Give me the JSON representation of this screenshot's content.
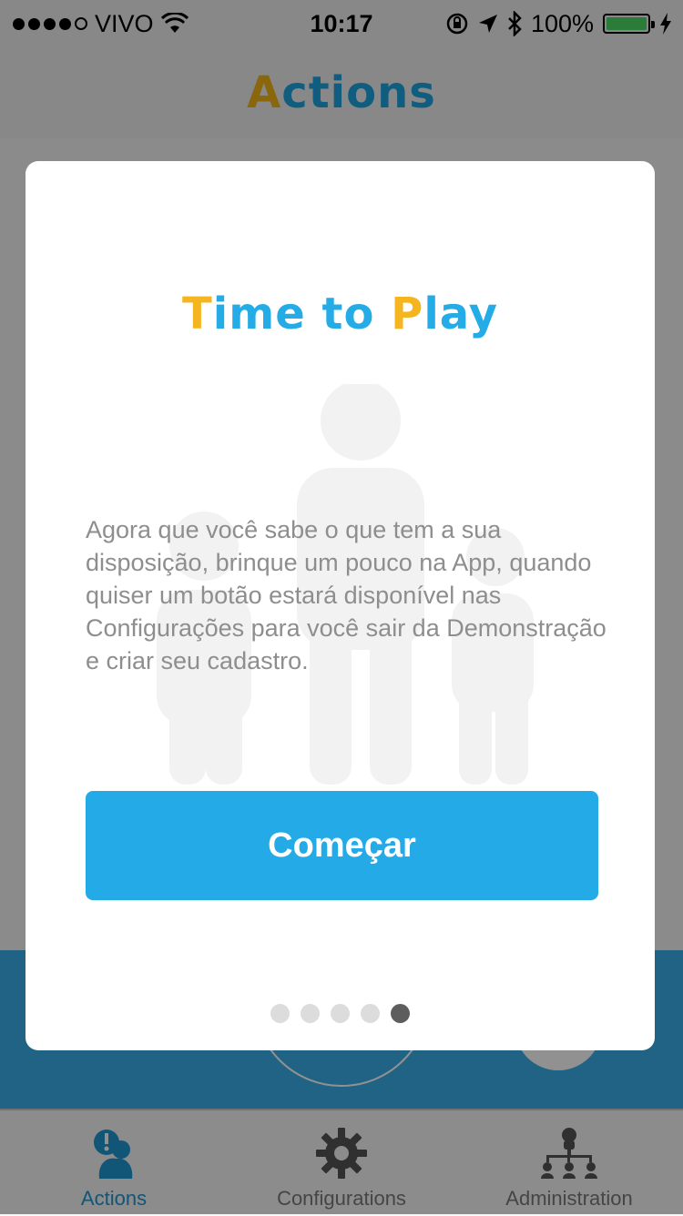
{
  "status_bar": {
    "carrier": "VIVO",
    "time": "10:17",
    "battery": "100%"
  },
  "nav": {
    "title_first": "A",
    "title_rest": "ctions"
  },
  "tabbar": {
    "tabs": [
      {
        "label": "Actions",
        "icon": "actions-icon",
        "active": true
      },
      {
        "label": "Configurations",
        "icon": "gear-icon",
        "active": false
      },
      {
        "label": "Administration",
        "icon": "hierarchy-icon",
        "active": false
      }
    ]
  },
  "modal": {
    "title_t": "T",
    "title_mid": "ime to ",
    "title_p": "P",
    "title_end": "lay",
    "body": "Agora que você sabe o que tem a sua disposição, brinque um pouco na App, quando quiser um botão estará disponível nas Configurações para você sair da Demonstração e criar seu cadastro.",
    "button": "Começar",
    "pages_total": 5,
    "current_page": 5
  },
  "colors": {
    "accent_blue": "#24abe7",
    "accent_yellow": "#f5b520"
  }
}
